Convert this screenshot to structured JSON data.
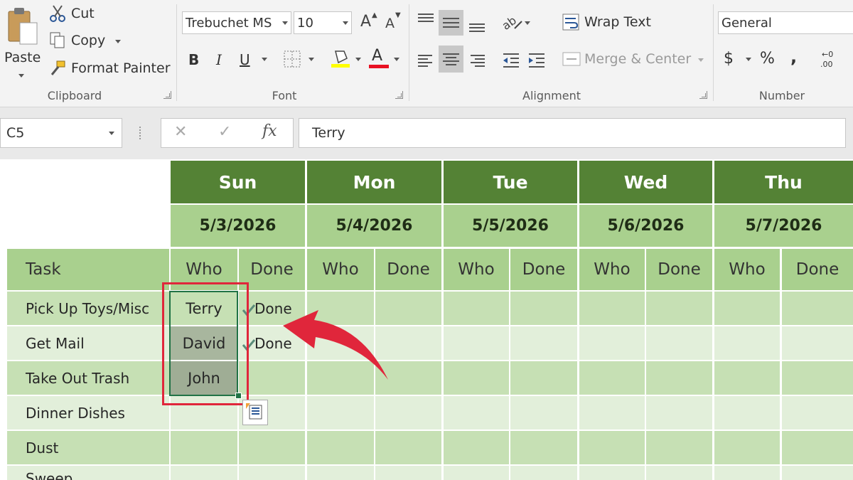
{
  "ribbon": {
    "clipboard": {
      "paste_label": "Paste",
      "cut_label": "Cut",
      "copy_label": "Copy",
      "format_painter_label": "Format Painter",
      "group_label": "Clipboard"
    },
    "font": {
      "font_name": "Trebuchet MS",
      "font_size": "10",
      "bold": "B",
      "italic": "I",
      "underline": "U",
      "grow_font": "A",
      "shrink_font": "A",
      "font_color_glyph": "A",
      "group_label": "Font",
      "highlight_color": "#ffff00",
      "font_color": "#e81123"
    },
    "alignment": {
      "wrap_text_label": "Wrap Text",
      "merge_center_label": "Merge & Center",
      "group_label": "Alignment"
    },
    "number": {
      "format": "General",
      "currency": "$",
      "percent": "%",
      "comma": ",",
      "group_label": "Number"
    }
  },
  "formula_bar": {
    "name_box": "C5",
    "cancel_glyph": "✕",
    "enter_glyph": "✓",
    "fx_label": "fx",
    "value": "Terry"
  },
  "sheet": {
    "days": [
      {
        "day": "Sun",
        "date": "5/3/2026"
      },
      {
        "day": "Mon",
        "date": "5/4/2026"
      },
      {
        "day": "Tue",
        "date": "5/5/2026"
      },
      {
        "day": "Wed",
        "date": "5/6/2026"
      },
      {
        "day": "Thu",
        "date": "5/7/2026"
      }
    ],
    "task_header": "Task",
    "who_header": "Who",
    "done_header": "Done",
    "rows": [
      {
        "task": "Pick Up Toys/Misc",
        "who": "Terry",
        "done": "Done"
      },
      {
        "task": "Get Mail",
        "who": "David",
        "done": "Done"
      },
      {
        "task": "Take Out Trash",
        "who": "John",
        "done": ""
      },
      {
        "task": "Dinner Dishes",
        "who": "",
        "done": ""
      },
      {
        "task": "Dust",
        "who": "",
        "done": ""
      },
      {
        "task": "Sweep",
        "who": "",
        "done": ""
      }
    ],
    "header_green": "#548235",
    "header_light": "#a9d08e",
    "band_dark": "#c6e0b4",
    "band_light": "#e2efda",
    "selection_border": "#217346",
    "callout_color": "#e0263b"
  }
}
